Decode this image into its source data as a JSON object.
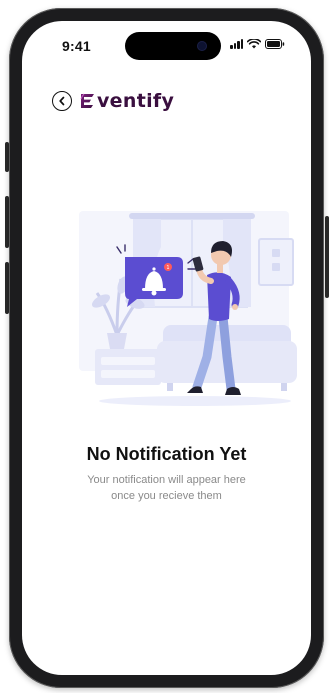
{
  "status_bar": {
    "time": "9:41",
    "icons": [
      "signal-icon",
      "wifi-icon",
      "battery-icon"
    ]
  },
  "header": {
    "back_icon": "chevron-left-icon",
    "app_name": "ventify",
    "logo_initial": "E"
  },
  "empty_state": {
    "title": "No Notification Yet",
    "description_line1": "Your notification will appear here",
    "description_line2": "once you recieve them",
    "illustration": "person-with-phone-and-notification-bell"
  },
  "colors": {
    "brand": "#3a0f3f",
    "accent": "#5b4dd1",
    "bell_badge": "#ff5a5a",
    "muted_text": "#8a8a8a",
    "illustration_light": "#e6e8f8"
  }
}
